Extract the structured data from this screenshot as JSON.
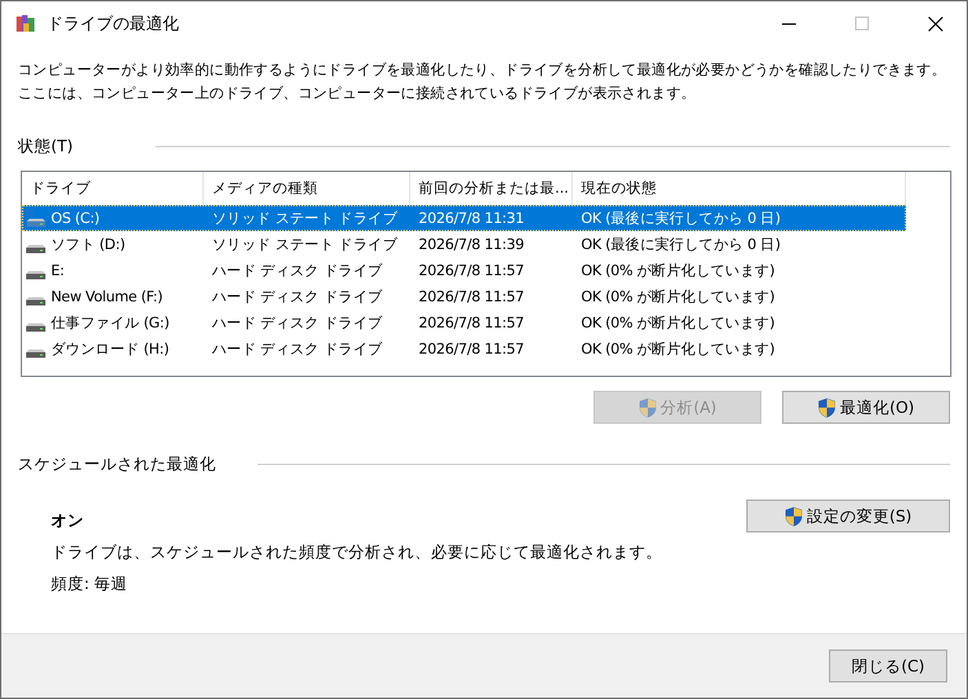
{
  "window": {
    "title": "ドライブの最適化"
  },
  "description": "コンピューターがより効率的に動作するようにドライブを最適化したり、ドライブを分析して最適化が必要かどうかを確認したりできます。ここには、コンピューター上のドライブ、コンピューターに接続されているドライブが表示されます。",
  "status_section": {
    "heading": "状態(T)"
  },
  "table": {
    "columns": [
      "ドライブ",
      "メディアの種類",
      "前回の分析または最...",
      "現在の状態"
    ],
    "rows": [
      {
        "kind": "system",
        "drive": "OS (C:)",
        "media": "ソリッド ステート ドライブ",
        "last": "2026/7/8 11:31",
        "status": "OK (最後に実行してから 0 日)",
        "selected": true
      },
      {
        "kind": "disk",
        "drive": "ソフト (D:)",
        "media": "ソリッド ステート ドライブ",
        "last": "2026/7/8 11:39",
        "status": "OK (最後に実行してから 0 日)",
        "selected": false
      },
      {
        "kind": "disk",
        "drive": "E:",
        "media": "ハード ディスク ドライブ",
        "last": "2026/7/8 11:57",
        "status": "OK (0% が断片化しています)",
        "selected": false
      },
      {
        "kind": "disk",
        "drive": "New Volume (F:)",
        "media": "ハード ディスク ドライブ",
        "last": "2026/7/8 11:57",
        "status": "OK (0% が断片化しています)",
        "selected": false
      },
      {
        "kind": "disk",
        "drive": "仕事ファイル (G:)",
        "media": "ハード ディスク ドライブ",
        "last": "2026/7/8 11:57",
        "status": "OK (0% が断片化しています)",
        "selected": false
      },
      {
        "kind": "disk",
        "drive": "ダウンロード (H:)",
        "media": "ハード ディスク ドライブ",
        "last": "2026/7/8 11:57",
        "status": "OK (0% が断片化しています)",
        "selected": false
      }
    ]
  },
  "actions": [
    {
      "label": "分析(A)",
      "disabled": true
    },
    {
      "label": "最適化(O)",
      "disabled": false
    }
  ],
  "schedule": {
    "heading": "スケジュールされた最適化",
    "state": "オン",
    "description": "ドライブは、スケジュールされた頻度で分析され、必要に応じて最適化されます。",
    "frequency": "頻度: 毎週",
    "button": "設定の変更(S)"
  },
  "close_button": "閉じる(C)"
}
